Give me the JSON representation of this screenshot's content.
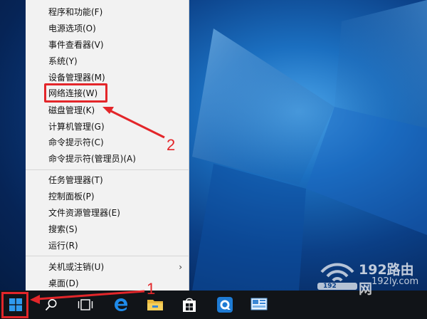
{
  "menu": {
    "items": [
      {
        "label": "程序和功能(F)"
      },
      {
        "label": "电源选项(O)"
      },
      {
        "label": "事件查看器(V)"
      },
      {
        "label": "系统(Y)"
      },
      {
        "label": "设备管理器(M)"
      },
      {
        "label": "网络连接(W)"
      },
      {
        "label": "磁盘管理(K)"
      },
      {
        "label": "计算机管理(G)"
      },
      {
        "label": "命令提示符(C)"
      },
      {
        "label": "命令提示符(管理员)(A)"
      },
      {
        "label": "任务管理器(T)"
      },
      {
        "label": "控制面板(P)"
      },
      {
        "label": "文件资源管理器(E)"
      },
      {
        "label": "搜索(S)"
      },
      {
        "label": "运行(R)"
      },
      {
        "label": "关机或注销(U)"
      },
      {
        "label": "桌面(D)"
      }
    ],
    "submenu_arrow": "›"
  },
  "annotations": {
    "step1": "1",
    "step2": "2",
    "color": "#e3262a"
  },
  "taskbar": {
    "icons": [
      "windows-start-icon",
      "search-icon",
      "task-view-icon",
      "edge-icon",
      "file-explorer-icon",
      "store-icon",
      "cortana-icon",
      "control-panel-icon"
    ]
  },
  "watermark": {
    "brand": "192路由网",
    "url": "192ly.com",
    "ip_text": "192"
  }
}
